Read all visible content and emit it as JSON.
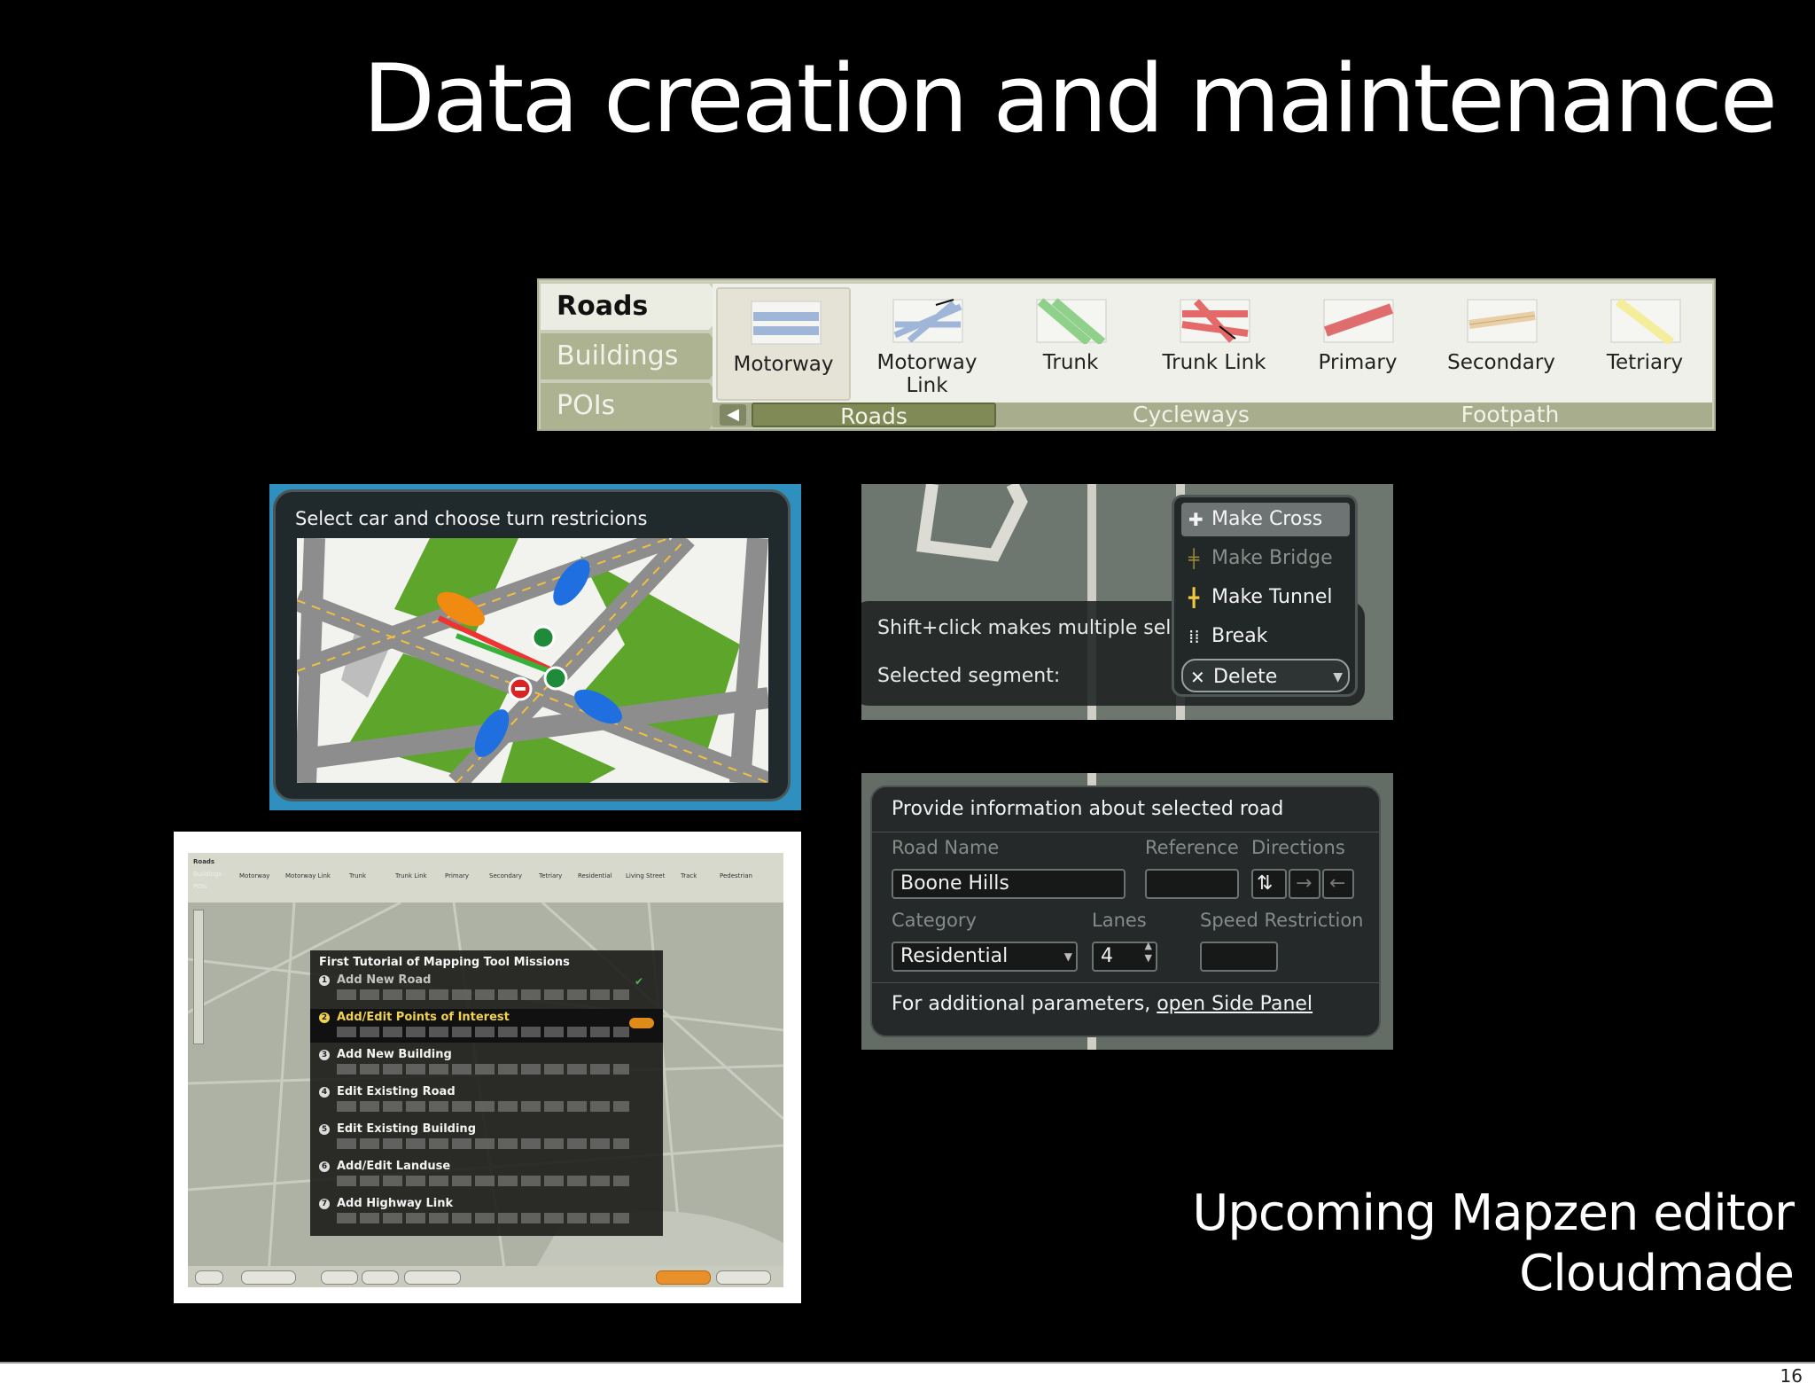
{
  "slide": {
    "title": "Data creation and maintenance",
    "caption_line1": "Upcoming Mapzen editor",
    "caption_line2": "Cloudmade",
    "page_number": "16"
  },
  "toolbar": {
    "left_tabs": [
      "Roads",
      "Buildings",
      "POIs"
    ],
    "active_left_tab": "Roads",
    "road_types": [
      {
        "label": "Motorway",
        "color": "#9fb6d8",
        "icon": "motorway-swatch"
      },
      {
        "label": "Motorway Link",
        "color": "#9fb6d8",
        "icon": "motorway-link-swatch"
      },
      {
        "label": "Trunk",
        "color": "#8fd08a",
        "icon": "trunk-swatch"
      },
      {
        "label": "Trunk Link",
        "color": "#e46a6a",
        "icon": "trunk-link-swatch"
      },
      {
        "label": "Primary",
        "color": "#e06d6d",
        "icon": "primary-swatch"
      },
      {
        "label": "Secondary",
        "color": "#e8cfa6",
        "icon": "secondary-swatch"
      },
      {
        "label": "Tetriary",
        "color": "#f4ee9c",
        "icon": "tertiary-swatch"
      }
    ],
    "selected_road_type": "Motorway",
    "category_tabs": [
      "Roads",
      "Cycleways",
      "Footpath"
    ],
    "active_category": "Roads"
  },
  "turn_restrictions": {
    "title": "Select car and choose turn restricions"
  },
  "segment_menu": {
    "hint": "Shift+click makes multiple sele",
    "selected_label": "Selected segment:",
    "items": [
      {
        "label": "Make Cross",
        "icon": "cross-icon",
        "state": "highlighted"
      },
      {
        "label": "Make Bridge",
        "icon": "bridge-icon",
        "state": "disabled"
      },
      {
        "label": "Make Tunnel",
        "icon": "tunnel-icon",
        "state": "normal"
      },
      {
        "label": "Break",
        "icon": "break-icon",
        "state": "normal"
      },
      {
        "label": "Delete",
        "icon": "delete-icon",
        "state": "dropdown"
      }
    ]
  },
  "road_info": {
    "title": "Provide information about selected road",
    "road_name_label": "Road Name",
    "road_name_value": "Boone Hills",
    "reference_label": "Reference",
    "reference_value": "",
    "directions_label": "Directions",
    "category_label": "Category",
    "category_value": "Residential",
    "lanes_label": "Lanes",
    "lanes_value": "4",
    "speed_label": "Speed Restriction",
    "speed_value": "",
    "footer_text": "For additional parameters, ",
    "footer_link": "open Side Panel"
  },
  "tutorial": {
    "heading": "First Tutorial of Mapping Tool Missions",
    "missions": [
      {
        "num": "1",
        "title": "Add New Road",
        "state": "done"
      },
      {
        "num": "2",
        "title": "Add/Edit Points of Interest",
        "state": "active"
      },
      {
        "num": "3",
        "title": "Add New Building",
        "state": "normal"
      },
      {
        "num": "4",
        "title": "Edit Existing Road",
        "state": "normal"
      },
      {
        "num": "5",
        "title": "Edit Existing Building",
        "state": "normal"
      },
      {
        "num": "6",
        "title": "Add/Edit Landuse",
        "state": "normal"
      },
      {
        "num": "7",
        "title": "Add Highway Link",
        "state": "normal"
      }
    ],
    "mini_tabs": [
      "Roads",
      "Buildings",
      "POIs"
    ],
    "mini_road_types": [
      "Motorway",
      "Motorway Link",
      "Trunk",
      "Trunk Link",
      "Primary",
      "Secondary",
      "Tetriary",
      "Residential",
      "Living Street",
      "Track",
      "Pedestrian"
    ]
  }
}
